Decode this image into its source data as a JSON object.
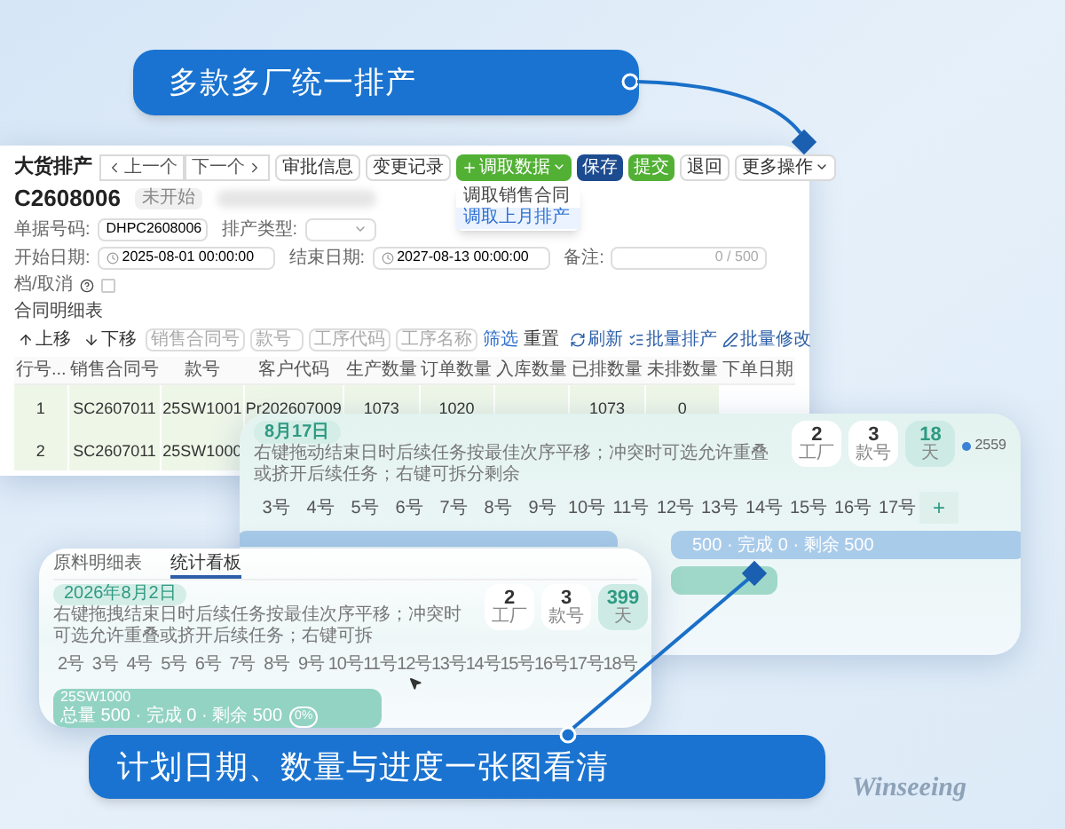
{
  "callouts": [
    {
      "text": "多款多厂统一排产"
    },
    {
      "text": "计划日期、数量与进度一张图看清"
    }
  ],
  "order_window": {
    "title": "大货排产",
    "nav_buttons": [
      {
        "label": "上一个"
      },
      {
        "label": "下一个"
      }
    ],
    "action_buttons": [
      {
        "label": "审批信息",
        "kind": "default",
        "dropdown": false
      },
      {
        "label": "变更记录",
        "kind": "default",
        "dropdown": false
      },
      {
        "label": "调取数据",
        "kind": "success",
        "dropdown": true
      },
      {
        "label": "保存",
        "kind": "primary",
        "dropdown": false
      },
      {
        "label": "提交",
        "kind": "success",
        "dropdown": false
      },
      {
        "label": "退回",
        "kind": "default",
        "dropdown": false
      },
      {
        "label": "更多操作",
        "kind": "default",
        "dropdown": true
      }
    ],
    "dropdown_items": [
      {
        "label": "调取销售合同",
        "selected": false
      },
      {
        "label": "调取上月排产",
        "selected": true
      }
    ],
    "doc_number": "C2608006",
    "status_badge": "未开始",
    "fields": [
      {
        "label": "单据号码:",
        "value": "DHPC2608006",
        "kind": "text"
      },
      {
        "label": "排产类型:",
        "kind": "select"
      },
      {
        "label": "开始日期:",
        "value": "2025-08-01 00:00:00",
        "kind": "date"
      },
      {
        "label": "结束日期:",
        "value": "2027-08-13 00:00:00",
        "kind": "date"
      },
      {
        "label": "备注:",
        "counter": "0 / 500",
        "kind": "textarea"
      }
    ],
    "cancel_option": {
      "label": "档/取消",
      "checked": false
    },
    "section_title": "合同明细表",
    "toolbar": {
      "move_buttons": [
        {
          "label": "上移"
        },
        {
          "label": "下移"
        }
      ],
      "filters": [
        {
          "placeholder": "销售合同号"
        },
        {
          "placeholder": "款号"
        },
        {
          "placeholder": "工序代码"
        },
        {
          "placeholder": "工序名称"
        }
      ],
      "filter_button": "筛选",
      "reset_button": "重置",
      "actions": [
        {
          "label": "刷新"
        },
        {
          "label": "批量排产"
        },
        {
          "label": "批量修改"
        }
      ]
    },
    "table": {
      "columns": [
        "行号...",
        "销售合同号",
        "款号",
        "客户代码",
        "生产数量",
        "订单数量",
        "入库数量",
        "已排数量",
        "未排数量",
        "下单日期"
      ],
      "rows": [
        [
          "1",
          "SC2607011",
          "25SW1001",
          "Pr202607009",
          "1073",
          "1020",
          null,
          "1073",
          "0"
        ],
        [
          "2",
          "SC2607011",
          "25SW1000"
        ]
      ]
    }
  },
  "gantt_window": {
    "date_badge": "8月17日",
    "description": "右键拖动结束日时后续任务按最佳次序平移；冲突时可选允许重叠或挤开后续任务；右键可拆分剩余",
    "stats": [
      {
        "value": "2",
        "label": "工厂",
        "selected": false
      },
      {
        "value": "3",
        "label": "款号",
        "selected": false
      },
      {
        "value": "18",
        "label": "天",
        "selected": true
      }
    ],
    "legend": "2559",
    "days": [
      "3号",
      "4号",
      "5号",
      "6号",
      "7号",
      "8号",
      "9号",
      "10号",
      "11号",
      "12号",
      "13号",
      "14号",
      "15号",
      "16号",
      "17号"
    ],
    "add_button": "+",
    "bars": [
      {
        "color": "#a9cbea"
      },
      {
        "color": "#a9cbea",
        "text": "500 · 完成 0 · 剩余 500"
      },
      {
        "color": "#9fd8c8"
      }
    ]
  },
  "plan_window": {
    "tabs": [
      {
        "label": "原料明细表",
        "selected": false
      },
      {
        "label": "统计看板",
        "selected": true
      }
    ],
    "date_badge": "2026年8月2日",
    "description": "右键拖拽结束日时后续任务按最佳次序平移；冲突时可选允许重叠或挤开后续任务；右键可拆",
    "stats": [
      {
        "value": "2",
        "label": "工厂",
        "selected": false
      },
      {
        "value": "3",
        "label": "款号",
        "selected": false
      },
      {
        "value": "399",
        "label": "天",
        "selected": true
      }
    ],
    "days": [
      "2号",
      "3号",
      "4号",
      "5号",
      "6号",
      "7号",
      "8号",
      "9号",
      "10号",
      "11号",
      "12号",
      "13号",
      "14号",
      "15号",
      "16号",
      "17号",
      "18号"
    ],
    "bar": {
      "title": "25SW1000",
      "detail": "总量 500 · 完成 0 · 剩余 500",
      "badge": "0%"
    }
  },
  "logo": "Winseeing"
}
